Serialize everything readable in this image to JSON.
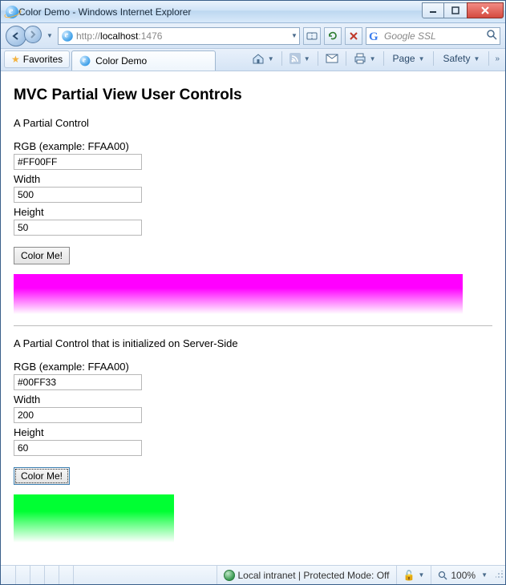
{
  "window": {
    "title": "Color Demo - Windows Internet Explorer"
  },
  "nav": {
    "url_display": "http://localhost:1476",
    "url_prefix": "http://",
    "url_host": "localhost",
    "url_rest": ":1476",
    "search_placeholder": "Google SSL"
  },
  "tabs": {
    "favorites_label": "Favorites",
    "tab1_label": "Color Demo"
  },
  "menus": {
    "page": "Page",
    "safety": "Safety"
  },
  "page": {
    "heading": "MVC Partial View User Controls",
    "section1": {
      "title": "A Partial Control",
      "rgb_label": "RGB (example: FFAA00)",
      "rgb_value": "#FF00FF",
      "width_label": "Width",
      "width_value": "500",
      "height_label": "Height",
      "height_value": "50",
      "button": "Color Me!",
      "swatch_color": "#FF00FF",
      "swatch_width": 560,
      "swatch_height": 50
    },
    "section2": {
      "title": "A Partial Control that is initialized on Server-Side",
      "rgb_label": "RGB (example: FFAA00)",
      "rgb_value": "#00FF33",
      "width_label": "Width",
      "width_value": "200",
      "height_label": "Height",
      "height_value": "60",
      "button": "Color Me!",
      "swatch_color": "#00FF33",
      "swatch_width": 200,
      "swatch_height": 60
    }
  },
  "status": {
    "zone": "Local intranet | Protected Mode: Off",
    "zoom": "100%"
  }
}
